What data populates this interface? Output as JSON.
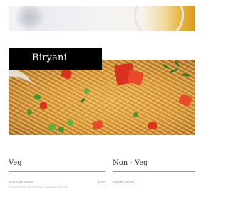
{
  "top_photo": {
    "alt_name": "decorative-top-photo"
  },
  "main_photo": {
    "dish": "biryani"
  },
  "banner": {
    "title": "Biryani"
  },
  "menu": {
    "veg": {
      "title": "Veg",
      "items": [
        {
          "name": "VEGETABLE BIRYANI",
          "price": "$12.95",
          "description": "fragrant basmati rice with mixed vegetables and spices"
        }
      ]
    },
    "non_veg": {
      "title": "Non - Veg",
      "items": [
        {
          "name": "CHICKEN BIRYANI",
          "price": "",
          "description": ""
        }
      ]
    }
  },
  "colors": {
    "banner_bg": "#000000",
    "banner_text": "#ffffff",
    "rule": "#9a9a9a"
  }
}
